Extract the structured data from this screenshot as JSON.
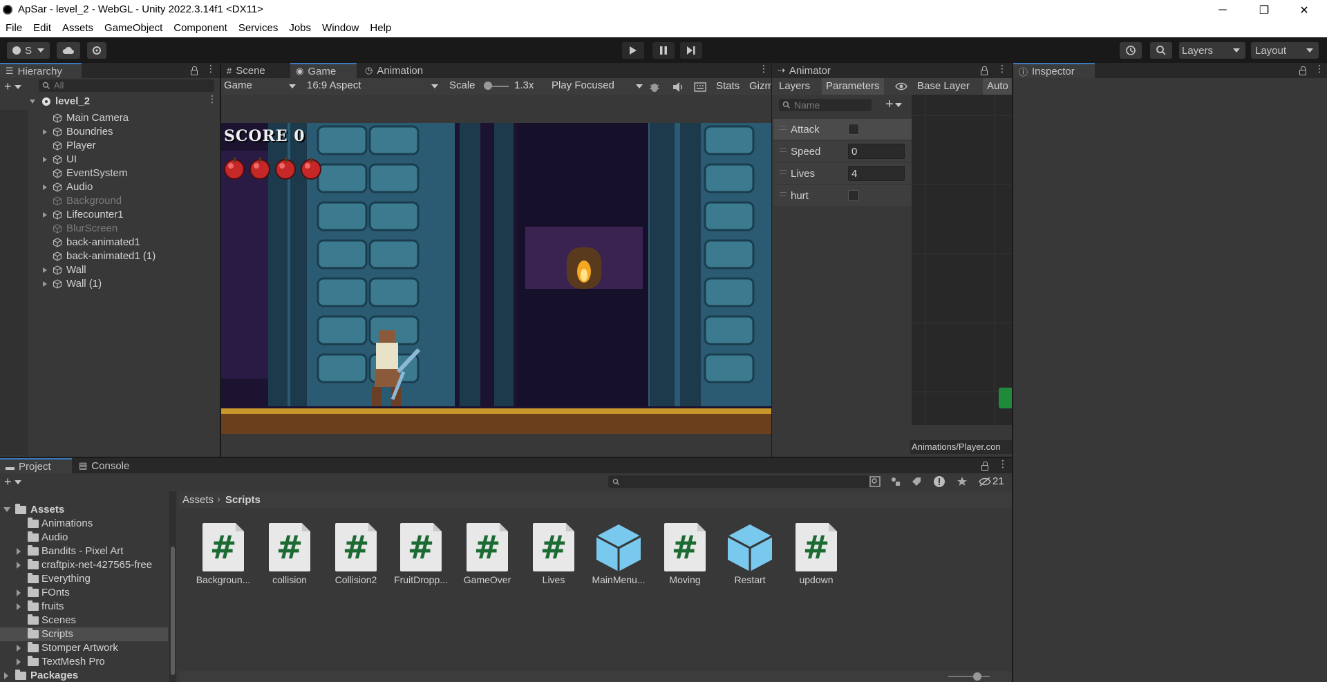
{
  "window": {
    "title": "ApSar - level_2 - WebGL - Unity 2022.3.14f1 <DX11>",
    "controls": [
      "─",
      "❐",
      "✕"
    ]
  },
  "menubar": [
    "File",
    "Edit",
    "Assets",
    "GameObject",
    "Component",
    "Services",
    "Jobs",
    "Window",
    "Help"
  ],
  "toolbar": {
    "account_label": "S",
    "layers_label": "Layers",
    "layout_label": "Layout"
  },
  "hierarchy": {
    "tab_label": "Hierarchy",
    "search_placeholder": "All",
    "scene_name": "level_2",
    "items": [
      {
        "label": "Main Camera"
      },
      {
        "label": "Boundries"
      },
      {
        "label": "Player"
      },
      {
        "label": "UI"
      },
      {
        "label": "EventSystem"
      },
      {
        "label": "Audio"
      },
      {
        "label": "Background"
      },
      {
        "label": "Lifecounter1"
      },
      {
        "label": "BlurScreen"
      },
      {
        "label": "back-animated1"
      },
      {
        "label": "back-animated1 (1)"
      },
      {
        "label": "Wall"
      },
      {
        "label": "Wall (1)"
      }
    ]
  },
  "game_view": {
    "tabs": [
      "Scene",
      "Game",
      "Animation"
    ],
    "display_dropdown": "Game",
    "aspect_dropdown": "16:9 Aspect",
    "scale_label": "Scale",
    "scale_value": "1.3x",
    "play_mode_dropdown": "Play Focused",
    "stats_label": "Stats",
    "gizmos_label": "Gizm",
    "hud": {
      "score_text": "SCORE 0",
      "apples_shown": 4
    }
  },
  "animator": {
    "tab_label": "Animator",
    "subtabs": [
      "Layers",
      "Parameters"
    ],
    "layer_name": "Base Layer",
    "auto_label": "Auto",
    "search_placeholder": "Name",
    "parameters": [
      {
        "name": "Attack",
        "type": "bool",
        "value": false
      },
      {
        "name": "Speed",
        "type": "float",
        "value": "0"
      },
      {
        "name": "Lives",
        "type": "int",
        "value": "4"
      },
      {
        "name": "hurt",
        "type": "bool",
        "value": false
      }
    ],
    "controller_path": "Animations/Player.con"
  },
  "inspector": {
    "tab_label": "Inspector"
  },
  "project": {
    "tabs": [
      "Project",
      "Console"
    ],
    "hidden_count": "21",
    "breadcrumb": [
      "Assets",
      "Scripts"
    ],
    "tree": [
      {
        "label": "Assets",
        "level": 0,
        "expanded": true
      },
      {
        "label": "Animations",
        "level": 1
      },
      {
        "label": "Audio",
        "level": 1
      },
      {
        "label": "Bandits - Pixel Art",
        "level": 1,
        "has_children": true
      },
      {
        "label": "craftpix-net-427565-free",
        "level": 1,
        "has_children": true
      },
      {
        "label": "Everything",
        "level": 1
      },
      {
        "label": "FOnts",
        "level": 1,
        "has_children": true
      },
      {
        "label": "fruits",
        "level": 1,
        "has_children": true
      },
      {
        "label": "Scenes",
        "level": 1
      },
      {
        "label": "Scripts",
        "level": 1,
        "selected": true
      },
      {
        "label": "Stomper Artwork",
        "level": 1,
        "has_children": true
      },
      {
        "label": "TextMesh Pro",
        "level": 1,
        "has_children": true
      },
      {
        "label": "Packages",
        "level": 0,
        "expanded": false
      }
    ],
    "assets": [
      {
        "name": "Backgroun...",
        "kind": "script"
      },
      {
        "name": "collision",
        "kind": "script"
      },
      {
        "name": "Collision2",
        "kind": "script"
      },
      {
        "name": "FruitDropp...",
        "kind": "script"
      },
      {
        "name": "GameOver",
        "kind": "script"
      },
      {
        "name": "Lives",
        "kind": "script"
      },
      {
        "name": "MainMenu...",
        "kind": "prefab"
      },
      {
        "name": "Moving",
        "kind": "script"
      },
      {
        "name": "Restart",
        "kind": "prefab"
      },
      {
        "name": "updown",
        "kind": "script"
      }
    ]
  },
  "colors": {
    "selected_folder_bg": "#4d4d4d",
    "active_tab_accent": "#3a79bb",
    "script_hash": "#1c6b33",
    "prefab_cube": "#79c8ee"
  }
}
